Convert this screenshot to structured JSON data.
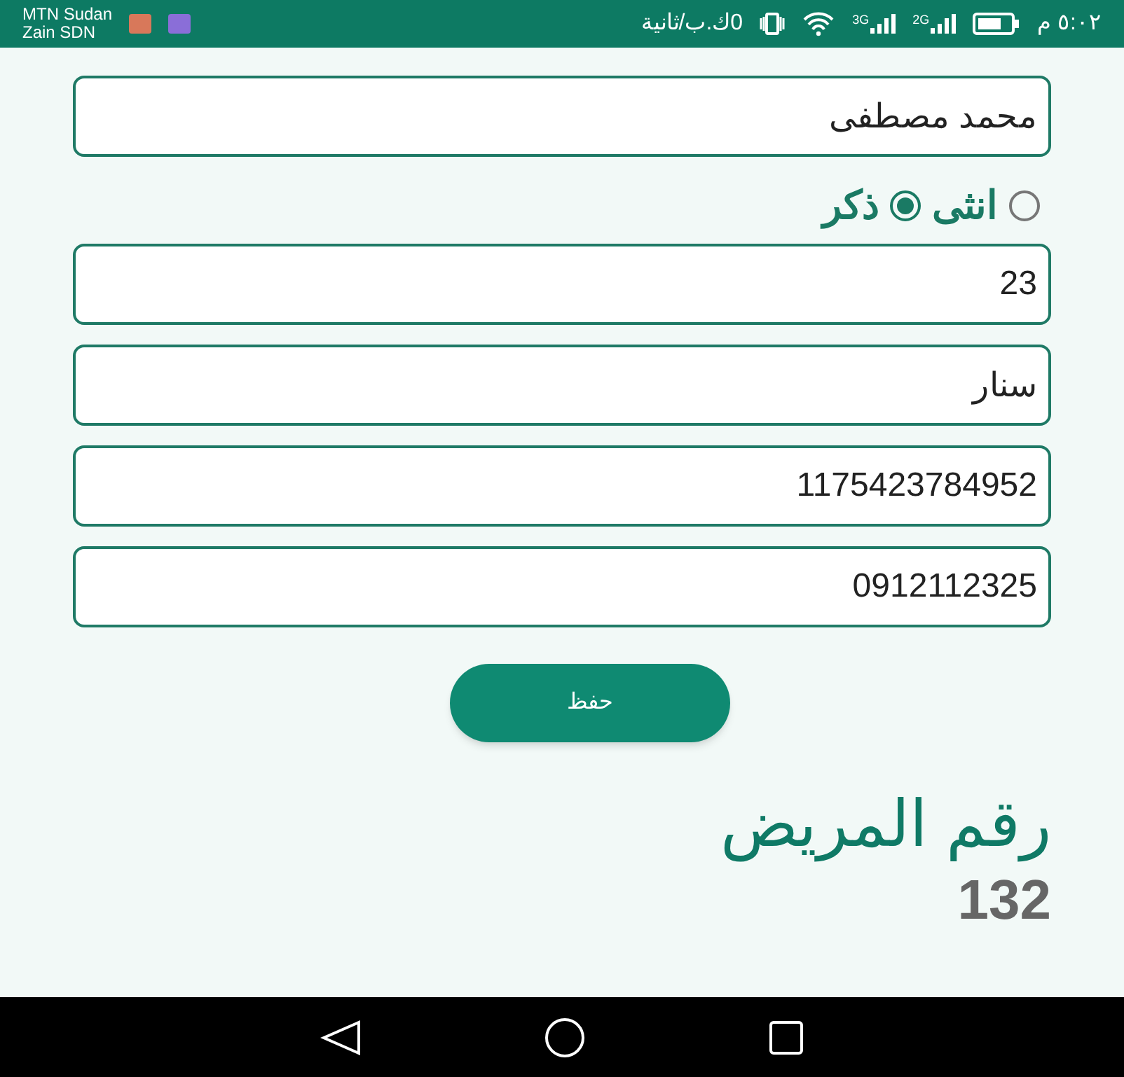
{
  "status_bar": {
    "carriers": [
      "MTN Sudan",
      "Zain SDN"
    ],
    "speed": "0ك.ب/ثانية",
    "networks": [
      "2G",
      "3G"
    ],
    "time": "٥:٠٢ م"
  },
  "form": {
    "name": "محمد مصطفى",
    "gender": [
      {
        "label": "انثى",
        "selected": false
      },
      {
        "label": "ذكر",
        "selected": true
      }
    ],
    "fields": [
      "23",
      "سنار",
      "1175423784952",
      "0912112325"
    ],
    "save_button": "حفظ"
  },
  "result": {
    "label": "رقم المريض",
    "value": "132"
  }
}
